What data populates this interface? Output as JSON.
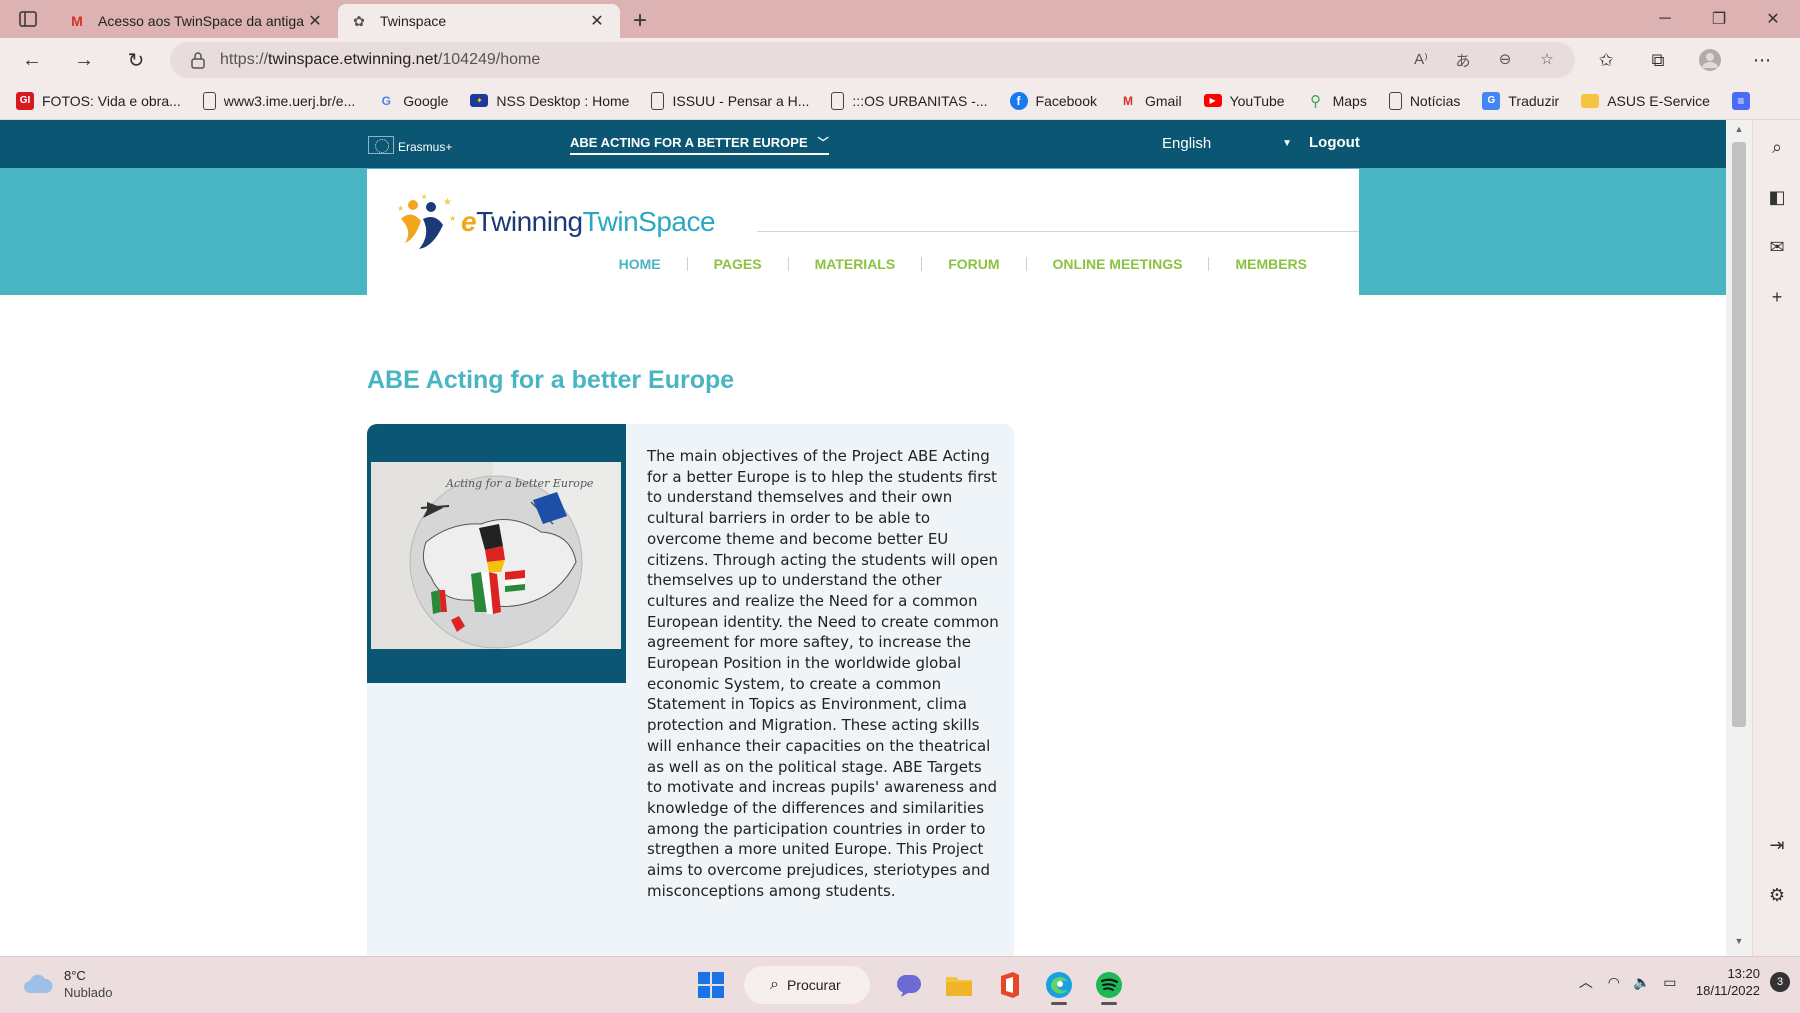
{
  "browser": {
    "tabs": [
      {
        "title": "Acesso aos TwinSpace da antiga",
        "active": false
      },
      {
        "title": "Twinspace",
        "active": true
      }
    ],
    "url": {
      "scheme": "https://",
      "host": "twinspace.etwinning.net",
      "path": "/104249/home"
    },
    "bookmarks": [
      {
        "label": "FOTOS: Vida e obra...",
        "icon": "gi-logo-icon"
      },
      {
        "label": "www3.ime.uerj.br/e...",
        "icon": "page-icon"
      },
      {
        "label": "Google",
        "icon": "google-icon"
      },
      {
        "label": "NSS Desktop : Home",
        "icon": "eu-flag-icon"
      },
      {
        "label": "ISSUU - Pensar a H...",
        "icon": "page-icon"
      },
      {
        "label": ":::OS URBANITAS -...",
        "icon": "page-icon"
      },
      {
        "label": "Facebook",
        "icon": "facebook-icon"
      },
      {
        "label": "Gmail",
        "icon": "gmail-icon"
      },
      {
        "label": "YouTube",
        "icon": "youtube-icon"
      },
      {
        "label": "Maps",
        "icon": "maps-icon"
      },
      {
        "label": "Notícias",
        "icon": "page-icon"
      },
      {
        "label": "Traduzir",
        "icon": "translate-icon"
      },
      {
        "label": "ASUS E-Service",
        "icon": "folder-icon"
      }
    ]
  },
  "site": {
    "brand": "Erasmus+",
    "project_menu": "ABE ACTING FOR A BETTER EUROPE",
    "language": "English",
    "logout": "Logout",
    "logo": {
      "e": "e",
      "twinning": "Twinning",
      "twinspace": "TwinSpace"
    },
    "nav": [
      "HOME",
      "PAGES",
      "MATERIALS",
      "FORUM",
      "ONLINE MEETINGS",
      "MEMBERS"
    ],
    "page_title": "ABE Acting for a better Europe",
    "image_caption": "Acting for a better Europe",
    "description": "The main objectives of the Project ABE Acting for a better Europe is to hlep the students first to understand themselves and their own cultural barriers in order to be able to overcome theme and become better EU citizens. Through acting the students will open themselves up to understand the other cultures and realize the Need for a common European identity. the Need to create common agreement for more saftey, to increase the European Position in the worldwide global economic System, to create a common Statement in Topics as Environment, clima protection and Migration. These acting skills will enhance their capacities on the theatrical as well as on the political stage. ABE Targets to motivate and increas pupils' awareness and knowledge of the differences and similarities among the participation countries in order to stregthen a more united Europe. This Project aims to overcome prejudices, steriotypes and misconceptions among students."
  },
  "taskbar": {
    "weather_temp": "8°C",
    "weather_condition": "Nublado",
    "search_label": "Procurar",
    "time": "13:20",
    "date": "18/11/2022",
    "notifications": "3"
  },
  "colors": {
    "site_dark": "#0b5672",
    "site_teal": "#49b5c3",
    "nav_green": "#8bc240",
    "chrome_pink": "#dcb3b2"
  }
}
